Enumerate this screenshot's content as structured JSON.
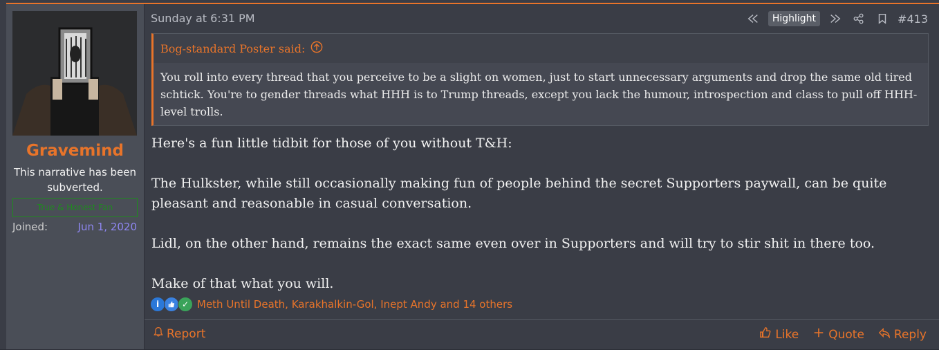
{
  "user": {
    "name": "Gravemind",
    "title": "This narrative has been subverted.",
    "banner": "True & Honest Fan",
    "joined_label": "Joined:",
    "joined_value": "Jun 1, 2020"
  },
  "header": {
    "date": "Sunday at 6:31 PM",
    "highlight": "Highlight",
    "post_number": "#413"
  },
  "quote": {
    "author": "Bog-standard Poster said:",
    "text": "You roll into every thread that you perceive to be a slight on women, just to start unnecessary arguments and drop the same old tired schtick. You're to gender threads what HHH is to Trump threads, except you lack the humour, introspection and class to pull off HHH-level trolls."
  },
  "body": {
    "p1": "Here's a fun little tidbit for those of you without T&H:",
    "p2": "The Hulkster, while still occasionally making fun of people behind the secret Supporters paywall, can be quite pleasant and reasonable in casual conversation.",
    "p3": "Lidl, on the other hand, remains the exact same even over in Supporters and will try to stir shit in there too.",
    "p4": "Make of that what you will."
  },
  "reactions": {
    "list": "Meth Until Death, Karakhalkin-Gol, Inept Andy and 14 others",
    "icons": [
      "informative-icon",
      "like-icon",
      "agree-icon"
    ]
  },
  "footer": {
    "report": "Report",
    "like": "Like",
    "quote": "Quote",
    "reply": "Reply"
  },
  "colors": {
    "accent": "#e8742a",
    "background": "#3a3d46",
    "sidebar": "#4a4e57",
    "joined_value": "#8e86f0",
    "banner": "#1f8a1f"
  }
}
